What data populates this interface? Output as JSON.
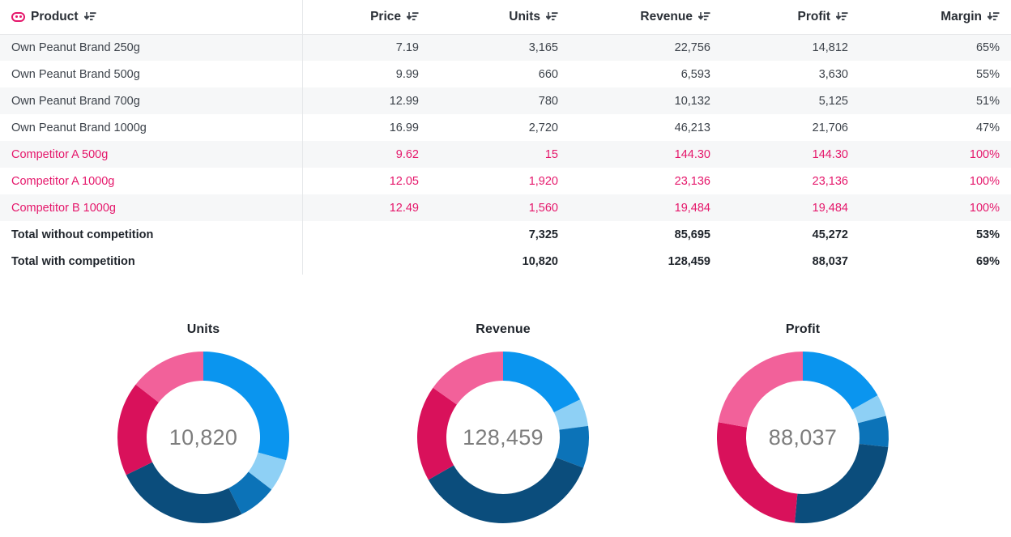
{
  "table": {
    "columns": [
      {
        "key": "product",
        "label": "Product",
        "align": "left",
        "icon": "dimension-icon",
        "sort_icon": "sort-desc-icon"
      },
      {
        "key": "price",
        "label": "Price",
        "align": "right",
        "sort_icon": "sort-desc-icon"
      },
      {
        "key": "units",
        "label": "Units",
        "align": "right",
        "sort_icon": "sort-desc-icon"
      },
      {
        "key": "revenue",
        "label": "Revenue",
        "align": "right",
        "sort_icon": "sort-desc-icon"
      },
      {
        "key": "profit",
        "label": "Profit",
        "align": "right",
        "sort_icon": "sort-desc-icon"
      },
      {
        "key": "margin",
        "label": "Margin",
        "align": "right",
        "sort_icon": "sort-desc-icon"
      }
    ],
    "rows": [
      {
        "product": "Own Peanut Brand 250g",
        "price": "7.19",
        "units": "3,165",
        "revenue": "22,756",
        "profit": "14,812",
        "margin": "65%",
        "style": "own"
      },
      {
        "product": "Own Peanut Brand 500g",
        "price": "9.99",
        "units": "660",
        "revenue": "6,593",
        "profit": "3,630",
        "margin": "55%",
        "style": "own"
      },
      {
        "product": "Own Peanut Brand 700g",
        "price": "12.99",
        "units": "780",
        "revenue": "10,132",
        "profit": "5,125",
        "margin": "51%",
        "style": "own"
      },
      {
        "product": "Own Peanut Brand 1000g",
        "price": "16.99",
        "units": "2,720",
        "revenue": "46,213",
        "profit": "21,706",
        "margin": "47%",
        "style": "own"
      },
      {
        "product": "Competitor A 500g",
        "price": "9.62",
        "units": "15",
        "revenue": "144.30",
        "profit": "144.30",
        "margin": "100%",
        "style": "competitor"
      },
      {
        "product": "Competitor A 1000g",
        "price": "12.05",
        "units": "1,920",
        "revenue": "23,136",
        "profit": "23,136",
        "margin": "100%",
        "style": "competitor"
      },
      {
        "product": "Competitor B 1000g",
        "price": "12.49",
        "units": "1,560",
        "revenue": "19,484",
        "profit": "19,484",
        "margin": "100%",
        "style": "competitor"
      },
      {
        "product": "Total without competition",
        "price": "",
        "units": "7,325",
        "revenue": "85,695",
        "profit": "45,272",
        "margin": "53%",
        "style": "total"
      },
      {
        "product": "Total with competition",
        "price": "",
        "units": "10,820",
        "revenue": "128,459",
        "profit": "88,037",
        "margin": "69%",
        "style": "total"
      }
    ]
  },
  "colors": {
    "accent_pink": "#e5176b",
    "segment_1": "#0a95ef",
    "segment_2": "#8ed0f5",
    "segment_3": "#0c73b8",
    "segment_4": "#0b4d7c",
    "segment_5": "#d9115b",
    "segment_6": "#f2619a",
    "row_alt": "#f6f7f8",
    "center_text": "#7d7d7d"
  },
  "chart_data": [
    {
      "type": "pie",
      "title": "Units",
      "center_label": "10,820",
      "total": 10820,
      "categories": [
        "Own Peanut Brand 250g",
        "Own Peanut Brand 500g",
        "Own Peanut Brand 700g",
        "Own Peanut Brand 1000g",
        "Competitor A 1000g",
        "Competitor B 1000g"
      ],
      "values": [
        3165,
        660,
        780,
        2720,
        1920,
        1560
      ],
      "percents": [
        29.3,
        6.1,
        7.2,
        25.1,
        17.7,
        14.4
      ],
      "colors": [
        "#0a95ef",
        "#8ed0f5",
        "#0c73b8",
        "#0b4d7c",
        "#d9115b",
        "#f2619a"
      ],
      "legend": "none",
      "donut": true,
      "start_angle": 0
    },
    {
      "type": "pie",
      "title": "Revenue",
      "center_label": "128,459",
      "total": 128459,
      "categories": [
        "Own Peanut Brand 250g",
        "Own Peanut Brand 500g",
        "Own Peanut Brand 700g",
        "Own Peanut Brand 1000g",
        "Competitor A 1000g",
        "Competitor B 1000g"
      ],
      "values": [
        22756,
        6593,
        10132,
        46213,
        23136,
        19484
      ],
      "percents": [
        17.7,
        5.1,
        7.9,
        36.0,
        18.0,
        15.2
      ],
      "colors": [
        "#0a95ef",
        "#8ed0f5",
        "#0c73b8",
        "#0b4d7c",
        "#d9115b",
        "#f2619a"
      ],
      "legend": "none",
      "donut": true,
      "start_angle": 0
    },
    {
      "type": "pie",
      "title": "Profit",
      "center_label": "88,037",
      "total": 88037,
      "categories": [
        "Own Peanut Brand 250g",
        "Own Peanut Brand 500g",
        "Own Peanut Brand 700g",
        "Own Peanut Brand 1000g",
        "Competitor A 1000g",
        "Competitor B 1000g"
      ],
      "values": [
        14812,
        3630,
        5125,
        21706,
        23136,
        19484
      ],
      "percents": [
        16.8,
        4.1,
        5.8,
        24.7,
        26.3,
        22.1
      ],
      "colors": [
        "#0a95ef",
        "#8ed0f5",
        "#0c73b8",
        "#0b4d7c",
        "#d9115b",
        "#f2619a"
      ],
      "legend": "none",
      "donut": true,
      "start_angle": 0
    }
  ]
}
